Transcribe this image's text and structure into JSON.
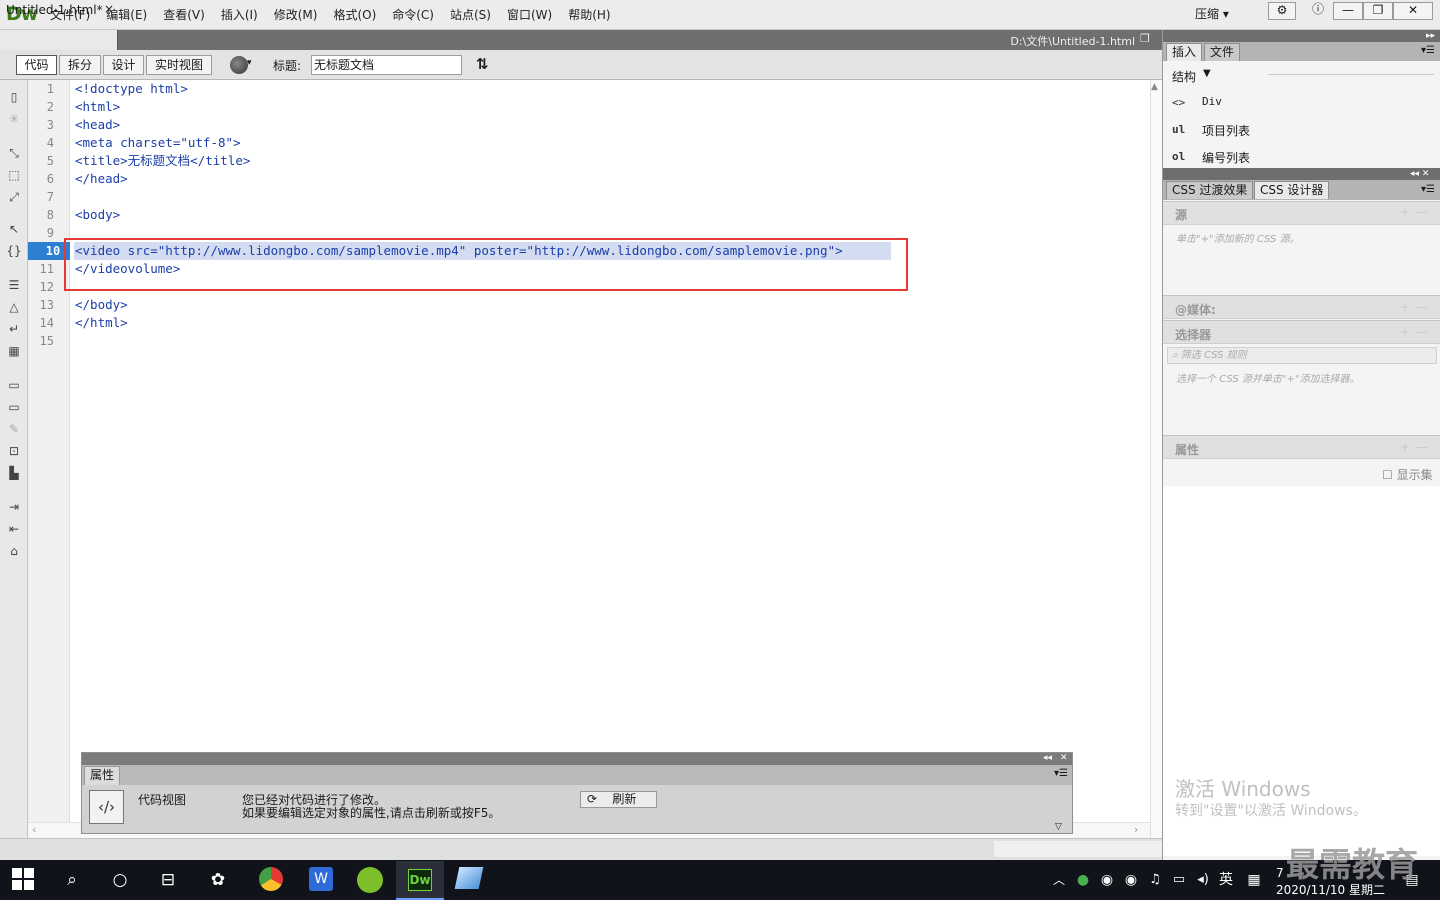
{
  "app": {
    "logo": "Dw",
    "compress_label": "压缩 ▾",
    "menu": [
      "文件(F)",
      "编辑(E)",
      "查看(V)",
      "插入(I)",
      "修改(M)",
      "格式(O)",
      "命令(C)",
      "站点(S)",
      "窗口(W)",
      "帮助(H)"
    ]
  },
  "window_controls": {
    "gear": "⚙",
    "info": "ⓘ",
    "minimize": "—",
    "restore": "❐",
    "close": "✕"
  },
  "doc": {
    "tab": "Untitled-1.html*",
    "close": "×",
    "path": "D:\\文件\\Untitled-1.html"
  },
  "toolbar": {
    "views": [
      "代码",
      "拆分",
      "设计",
      "实时视图"
    ],
    "active_view": "代码",
    "title_label": "标题:",
    "title_value": "无标题文档"
  },
  "code": {
    "current_line": 10,
    "lines": [
      "<!doctype html>",
      "<html>",
      "<head>",
      "<meta charset=\"utf-8\">",
      "<title>无标题文档</title>",
      "</head>",
      "",
      "<body>",
      "",
      "<video src=\"http://www.lidongbo.com/samplemovie.mp4\" poster=\"http://www.lidongbo.com/samplemovie.png\">",
      "</videovolume>",
      "",
      "</body>",
      "</html>",
      ""
    ],
    "line_numbers": [
      "1",
      "2",
      "3",
      "4",
      "5",
      "6",
      "7",
      "8",
      "9",
      "10",
      "11",
      "12",
      "13",
      "14",
      "15"
    ]
  },
  "properties": {
    "tab": "属性",
    "view_label": "代码视图",
    "msg1": "您已经对代码进行了修改。",
    "msg2": "如果要编辑选定对象的属性,请点击刷新或按F5。",
    "refresh": "刷新"
  },
  "insert_panel": {
    "tabs": [
      "插入",
      "文件"
    ],
    "category": "结构",
    "items": [
      {
        "icon": "<>",
        "label": "Div"
      },
      {
        "icon": "ul",
        "label": "项目列表"
      },
      {
        "icon": "ol",
        "label": "编号列表"
      }
    ]
  },
  "css_panel": {
    "tabs": [
      "CSS 过渡效果",
      "CSS 设计器"
    ],
    "source": "源",
    "source_hint": "单击\"+\"添加新的 CSS 源。",
    "media": "@媒体:",
    "selector": "选择器",
    "filter_placeholder": "筛选 CSS 规则",
    "selector_hint": "选择一个 CSS 源并单击\"+\"添加选择器。",
    "props": "属性",
    "show_set": "显示集"
  },
  "activation": {
    "line1": "激活 Windows",
    "line2": "转到\"设置\"以激活 Windows。"
  },
  "taskbar": {
    "date": "2020/11/10 星期二",
    "time": "7",
    "ime": "英"
  },
  "watermark": "最需教育"
}
